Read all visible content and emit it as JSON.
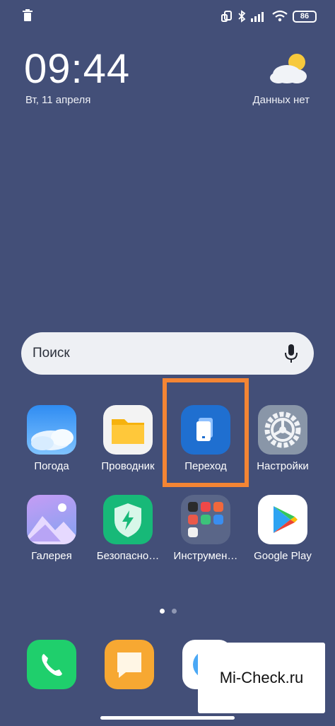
{
  "status_bar": {
    "battery": "86",
    "icons": [
      "trash-icon",
      "screen-rotate-icon",
      "bluetooth-icon",
      "signal-icon",
      "wifi-icon",
      "battery-icon"
    ]
  },
  "clock": {
    "time": "09:44",
    "date": "Вт, 11 апреля"
  },
  "weather": {
    "text": "Данных нет",
    "icon": "cloud-sun-icon"
  },
  "search": {
    "placeholder": "Поиск",
    "icon": "microphone-icon"
  },
  "apps_row1": [
    {
      "label": "Погода",
      "icon": "weather-app-icon"
    },
    {
      "label": "Проводник",
      "icon": "folder-icon"
    },
    {
      "label": "Переход",
      "icon": "transfer-icon"
    },
    {
      "label": "Настройки",
      "icon": "settings-gear-icon"
    }
  ],
  "apps_row2": [
    {
      "label": "Галерея",
      "icon": "gallery-icon"
    },
    {
      "label": "Безопасно…",
      "icon": "security-shield-icon"
    },
    {
      "label": "Инструмен…",
      "icon": "tools-folder-icon"
    },
    {
      "label": "Google Play",
      "icon": "google-play-icon"
    }
  ],
  "dock": [
    {
      "icon": "phone-icon"
    },
    {
      "icon": "messages-icon"
    },
    {
      "icon": "browser-icon"
    }
  ],
  "watermark": "Mi-Check.ru",
  "colors": {
    "background": "#434f78",
    "highlight": "#f48534"
  }
}
